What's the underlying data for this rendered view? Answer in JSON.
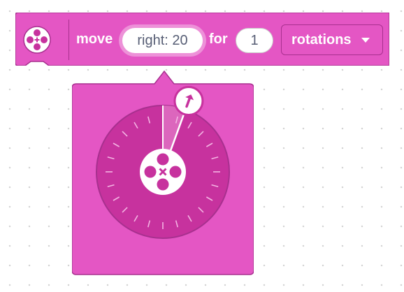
{
  "block": {
    "icon": "motor-wheel-icon",
    "move_label": "move",
    "direction_value": "right: 20",
    "for_label": "for",
    "amount_value": "1",
    "unit_selected": "rotations",
    "unit_dropdown_icon": "caret-down-icon"
  },
  "dial": {
    "direction": "right",
    "degrees": 20,
    "handle_icon": "arrow-up-right-icon",
    "center_icon": "motor-wheel-icon"
  },
  "colors": {
    "block_fill": "#e456c4",
    "block_border": "#a8308f",
    "dial_fill": "#c7329e",
    "dial_ring": "#a8308f",
    "text": "#ffffff",
    "field_text": "#575e75"
  }
}
